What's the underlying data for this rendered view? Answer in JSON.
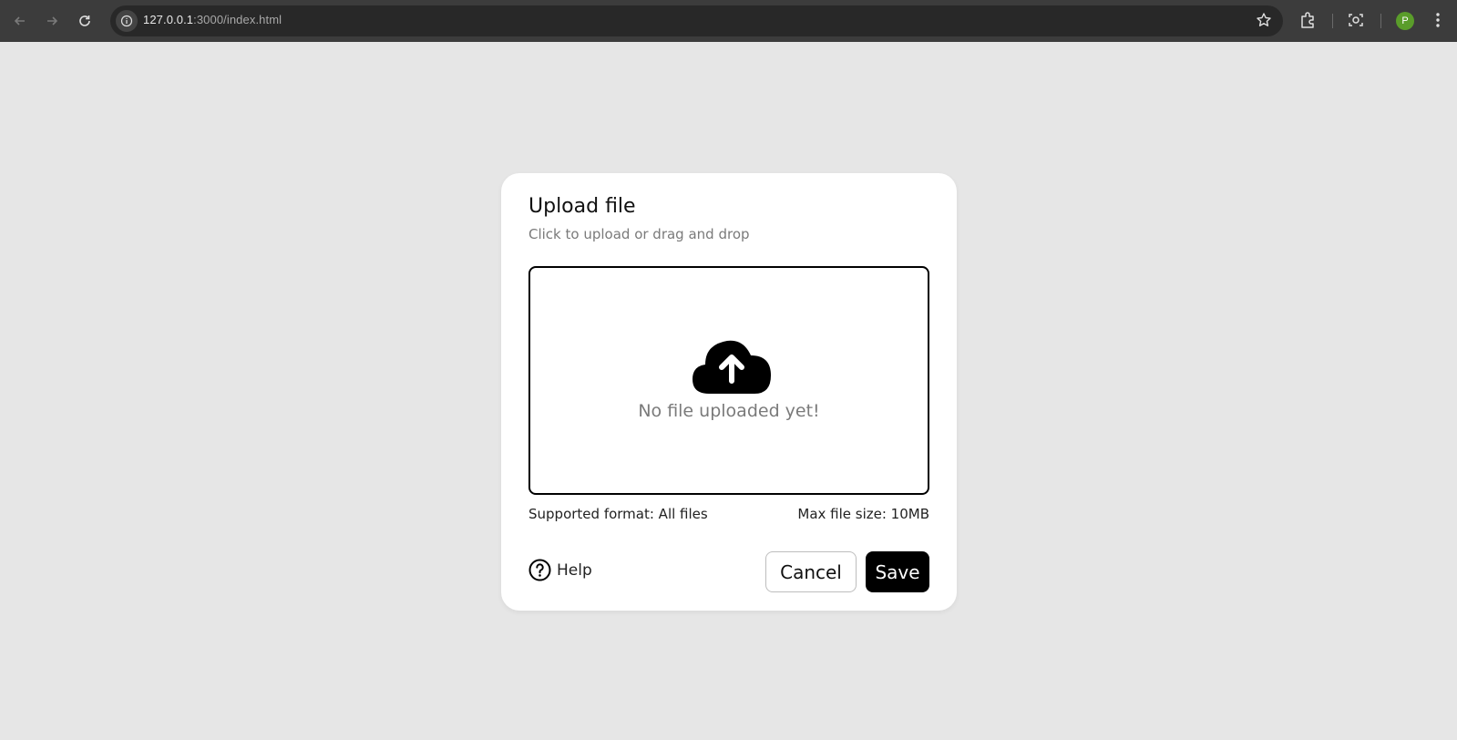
{
  "browser": {
    "url_host": "127.0.0.1",
    "url_path": ":3000/index.html",
    "profile_initial": "P",
    "icons": [
      "back-icon",
      "forward-icon",
      "reload-icon",
      "site-info-icon",
      "bookmark-star-icon",
      "extensions-icon",
      "screenshot-icon",
      "avatar",
      "menu-icon"
    ]
  },
  "dialog": {
    "title": "Upload file",
    "subtitle": "Click to upload or drag and drop",
    "dropzone": {
      "icon": "cloud-upload-icon",
      "empty_message": "No file uploaded yet!"
    },
    "supported_format": "Supported format: All files",
    "max_size": "Max file size: 10MB",
    "help_label": "Help",
    "cancel_label": "Cancel",
    "save_label": "Save"
  },
  "colors": {
    "page_background": "#e6e6e6",
    "browser_bar": "#3c3c3c",
    "primary_button": "#000000",
    "muted_text": "#7a7a7a",
    "avatar": "#5a9d2a"
  }
}
